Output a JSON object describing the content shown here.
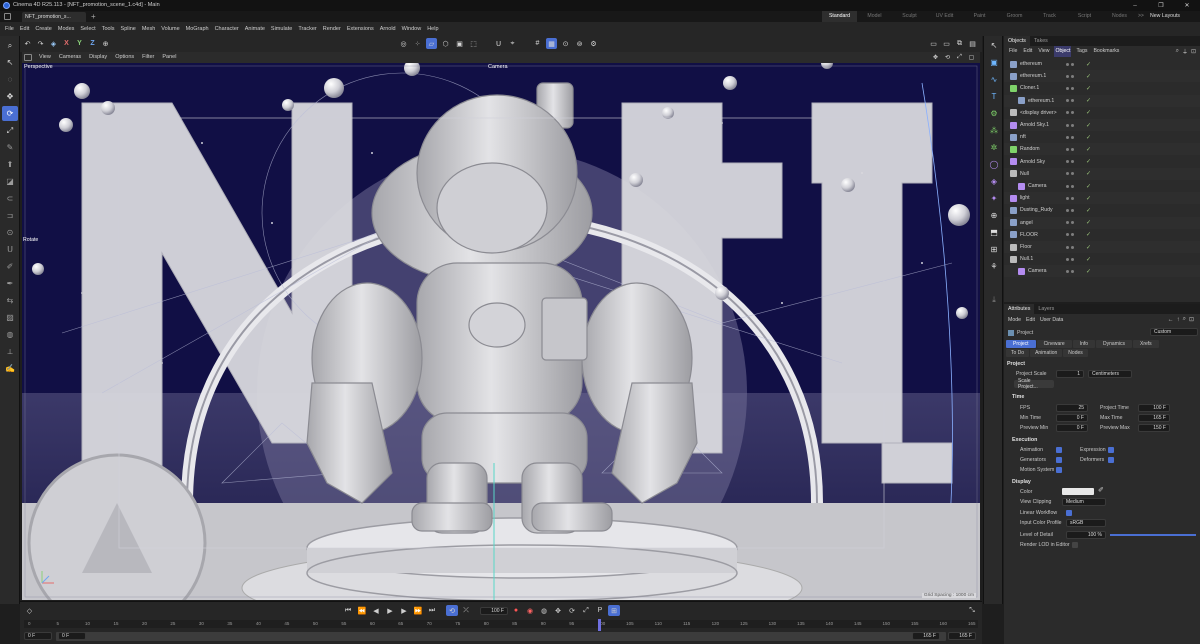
{
  "app": {
    "title": "Cinema 4D R25.113 - [NFT_promotion_scene_1.c4d] - Main",
    "file_tab": "NFT_promotion_s...",
    "new_tab": "+",
    "win_min": "─",
    "win_max": "❐",
    "win_close": "✕"
  },
  "layouts": {
    "items": [
      "Standard",
      "Model",
      "Sculpt",
      "UV Edit",
      "Paint",
      "Groom",
      "Track",
      "Script",
      "Nodes"
    ],
    "more": ">>",
    "new_layouts": "New Layouts"
  },
  "menu": [
    "File",
    "Edit",
    "Create",
    "Modes",
    "Select",
    "Tools",
    "Spline",
    "Mesh",
    "Volume",
    "MoGraph",
    "Character",
    "Animate",
    "Simulate",
    "Tracker",
    "Render",
    "Extensions",
    "Arnold",
    "Window",
    "Help"
  ],
  "toolbar": {
    "undo": "↶",
    "redo": "↷",
    "axis": [
      "X",
      "Y",
      "Z"
    ]
  },
  "viewport_menu": [
    "View",
    "Cameras",
    "Display",
    "Options",
    "Filter",
    "Panel"
  ],
  "viewport": {
    "name": "Perspective",
    "camera": "Camera",
    "rotate_hint": "Rotate",
    "grid_spacing": "Grid Spacing : 1000 cm",
    "letters": [
      "N",
      "F",
      "T"
    ]
  },
  "timeline": {
    "ruler": [
      "0",
      "5",
      "10",
      "15",
      "20",
      "25",
      "30",
      "35",
      "40",
      "45",
      "50",
      "55",
      "60",
      "65",
      "70",
      "75",
      "80",
      "85",
      "90",
      "95",
      "100",
      "105",
      "110",
      "115",
      "120",
      "125",
      "130",
      "135",
      "140",
      "145",
      "150",
      "155",
      "160",
      "165"
    ],
    "current_frame": "100 F",
    "start_field": "0 F",
    "start_field2": "0 F",
    "end_field": "165 F",
    "end_field2": "165 F",
    "playhead_frame": 100,
    "frame_count": 165
  },
  "objects": {
    "tabs": [
      "Objects",
      "Takes"
    ],
    "menu": [
      "File",
      "Edit",
      "View",
      "Object",
      "Tags",
      "Bookmarks"
    ],
    "items": [
      {
        "name": "ethereum",
        "indent": 0
      },
      {
        "name": "ethereum.1",
        "indent": 0
      },
      {
        "name": "Cloner.1",
        "indent": 0
      },
      {
        "name": "ethereum.1",
        "indent": 1
      },
      {
        "name": "<display driver>",
        "indent": 0
      },
      {
        "name": "Arnold Sky.1",
        "indent": 0
      },
      {
        "name": "nft",
        "indent": 0
      },
      {
        "name": "Random",
        "indent": 0
      },
      {
        "name": "Arnold Sky",
        "indent": 0
      },
      {
        "name": "Null",
        "indent": 0
      },
      {
        "name": "Camera",
        "indent": 1
      },
      {
        "name": "light",
        "indent": 0
      },
      {
        "name": "Dusting_Rudy",
        "indent": 0
      },
      {
        "name": "angel",
        "indent": 0
      },
      {
        "name": "FLOOR",
        "indent": 0
      },
      {
        "name": "Floor",
        "indent": 0
      },
      {
        "name": "Null.1",
        "indent": 0
      },
      {
        "name": "Camera",
        "indent": 1
      }
    ]
  },
  "attributes": {
    "tabs": [
      "Attributes",
      "Layers"
    ],
    "menu": [
      "Mode",
      "Edit",
      "User Data"
    ],
    "context": "Project",
    "preset": "Custom",
    "subtabs_row1": [
      "Project",
      "Cineware",
      "Info",
      "Dynamics",
      "Xrefs"
    ],
    "subtabs_row2": [
      "To Do",
      "Animation",
      "Nodes"
    ],
    "section_project": "Project",
    "project_scale_label": "Project Scale",
    "project_scale_value": "1",
    "project_scale_unit": "Centimeters",
    "scale_button": "Scale Project...",
    "section_time": "Time",
    "fps_label": "FPS",
    "fps_value": "25",
    "project_time_label": "Project Time",
    "project_time_value": "100 F",
    "min_time_label": "Min Time",
    "min_time_value": "0 F",
    "max_time_label": "Max Time",
    "max_time_value": "165 F",
    "preview_min_label": "Preview Min",
    "preview_min_value": "0 F",
    "preview_max_label": "Preview Max",
    "preview_max_value": "150 F",
    "section_execution": "Execution",
    "animation_label": "Animation",
    "expression_label": "Expression",
    "generators_label": "Generators",
    "deformers_label": "Deformers",
    "motion_label": "Motion System",
    "section_display": "Display",
    "color_label": "Color",
    "view_clipping_label": "View Clipping",
    "view_clipping_value": "Medium",
    "linear_label": "Linear Workflow",
    "input_profile_label": "Input Color Profile",
    "input_profile_value": "sRGB",
    "lod_label": "Level of Detail",
    "lod_value": "100 %",
    "render_lod_label": "Render LOD in Editor"
  }
}
